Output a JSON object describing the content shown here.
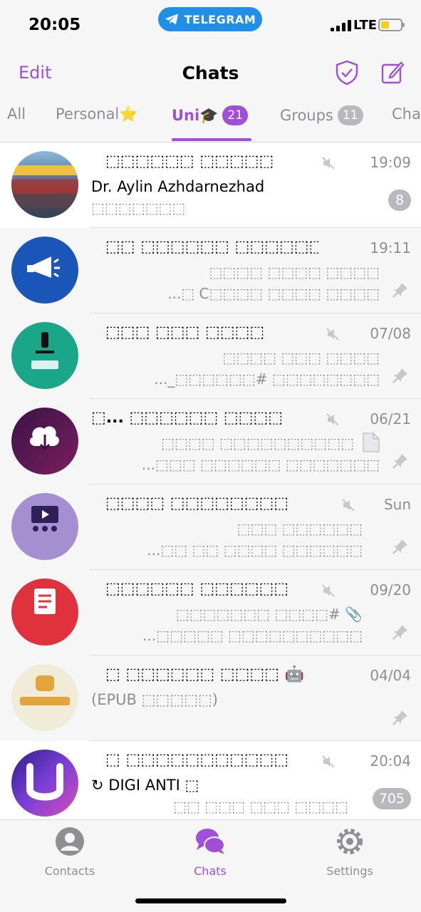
{
  "status": {
    "time": "20:05",
    "app_pill": "TELEGRAM",
    "network": "LTE",
    "battery_level": 0.3
  },
  "header": {
    "edit_label": "Edit",
    "title": "Chats",
    "icons": [
      "shield-check-icon",
      "compose-icon"
    ]
  },
  "folder_tabs": [
    {
      "label": "All"
    },
    {
      "label": "Personal⭐"
    },
    {
      "label": "Uni🎓",
      "badge": "21",
      "active": true
    },
    {
      "label": "Groups",
      "badge": "11"
    },
    {
      "label": "Cha"
    }
  ],
  "chats": [
    {
      "name": "⬚⬚⬚⬚⬚⬚ ⬚⬚⬚⬚⬚",
      "muted": true,
      "time": "19:09",
      "sender": "Dr. Aylin Azhdarnezhad",
      "line2": "⬚⬚⬚⬚⬚⬚⬚",
      "unread": "8",
      "pinned": false
    },
    {
      "name": "⬚⬚ ⬚⬚⬚⬚⬚⬚ ⬚⬚⬚⬚⬚⬚",
      "muted": false,
      "time": "19:11",
      "line1": "⬚⬚⬚⬚ ⬚⬚⬚⬚ ⬚⬚⬚⬚",
      "line2": "...⬚ C⬚⬚⬚⬚ ⬚⬚⬚⬚ ⬚⬚⬚⬚",
      "pinned": true
    },
    {
      "name": "⬚⬚⬚ ⬚⬚⬚ ⬚⬚⬚⬚",
      "muted": true,
      "time": "07/08",
      "line1": "⬚⬚⬚⬚ ⬚⬚⬚ ⬚⬚⬚⬚",
      "line2": "..._⬚⬚⬚⬚⬚⬚# ⬚⬚⬚⬚⬚⬚⬚⬚",
      "pinned": true
    },
    {
      "name": "⬚... ⬚⬚⬚⬚⬚⬚ ⬚⬚⬚⬚",
      "muted": true,
      "time": "06/21",
      "line1": "⬚⬚⬚⬚ ⬚⬚⬚⬚⬚⬚⬚⬚⬚⬚",
      "line2": "...⬚⬚⬚ ⬚⬚⬚⬚⬚⬚ ⬚⬚⬚⬚⬚⬚⬚",
      "pinned": true
    },
    {
      "name": "⬚⬚⬚⬚ ⬚⬚⬚⬚⬚⬚⬚⬚",
      "muted": true,
      "time": "Sun",
      "line1": "⬚⬚⬚ ⬚⬚⬚⬚⬚⬚",
      "line2": "...⬚⬚ ⬚⬚ ⬚⬚⬚⬚ ⬚⬚⬚⬚⬚⬚",
      "pinned": true
    },
    {
      "name": "⬚⬚⬚⬚⬚⬚ ⬚⬚⬚⬚⬚⬚",
      "muted": true,
      "time": "09/20",
      "line1": "⬚⬚⬚⬚⬚⬚⬚ ⬚⬚⬚⬚# 📎",
      "line2": "...⬚⬚⬚⬚⬚ ⬚⬚⬚⬚⬚⬚⬚⬚⬚⬚",
      "pinned": true
    },
    {
      "name": "⬚ ⬚⬚⬚⬚⬚⬚ ⬚⬚⬚⬚ 🤖",
      "muted": false,
      "time": "04/04",
      "sender": "(EPUB ⬚⬚⬚⬚⬚)",
      "pinned": true
    },
    {
      "name": "⬚ ⬚⬚⬚⬚⬚⬚⬚⬚⬚⬚⬚",
      "muted": true,
      "time": "20:04",
      "sender": "↻ DIGI ANTI ⬚",
      "line2": "⬚⬚ ⬚⬚⬚ ⬚⬚⬚ ⬚⬚⬚⬚",
      "unread": "705",
      "pinned": false
    }
  ],
  "tabbar": {
    "contacts": "Contacts",
    "chats": "Chats",
    "settings": "Settings"
  },
  "colors": {
    "accent": "#a04fd6",
    "telegram_blue": "#1f8fe8"
  }
}
